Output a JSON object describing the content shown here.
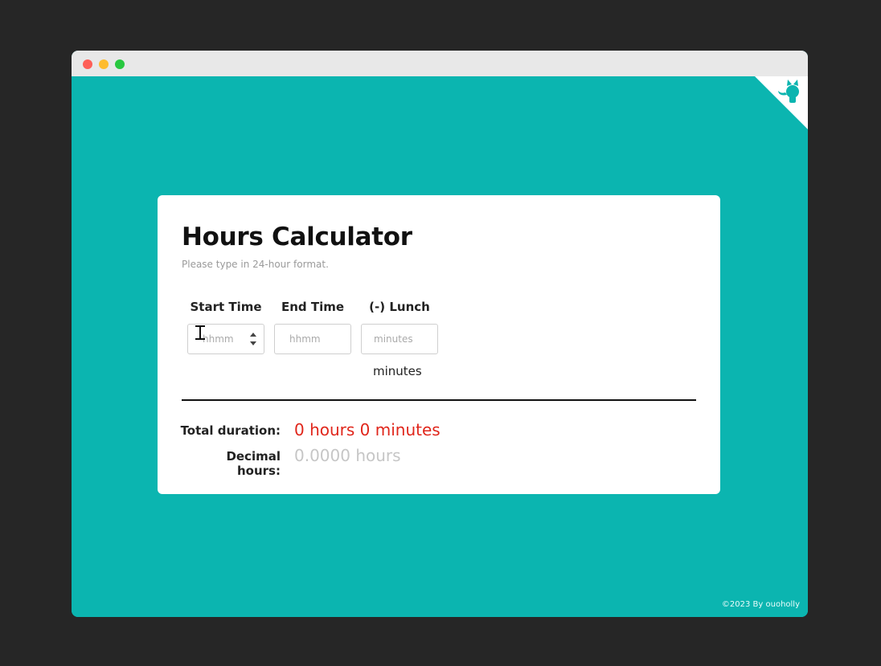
{
  "window": {
    "controls": [
      "close",
      "minimize",
      "maximize"
    ]
  },
  "corner": {
    "icon": "github-octocat-icon",
    "color": "#0bb5b0"
  },
  "card": {
    "title": "Hours Calculator",
    "subtitle": "Please type in 24-hour format."
  },
  "fields": {
    "start": {
      "label": "Start Time",
      "placeholder": "hhmm",
      "value": ""
    },
    "end": {
      "label": "End Time",
      "placeholder": "hhmm",
      "value": ""
    },
    "lunch": {
      "label": "(-) Lunch",
      "placeholder": "minutes",
      "value": "",
      "suffix": "minutes"
    }
  },
  "results": {
    "total_label": "Total duration:",
    "total_value": "0 hours 0 minutes",
    "decimal_label": "Decimal hours:",
    "decimal_value": "0.0000 hours"
  },
  "footer": {
    "text": "©2023 By ouoholly"
  },
  "colors": {
    "background": "#0bb5b0",
    "total_value": "#e0261b",
    "decimal_value": "#c6c6c6"
  }
}
